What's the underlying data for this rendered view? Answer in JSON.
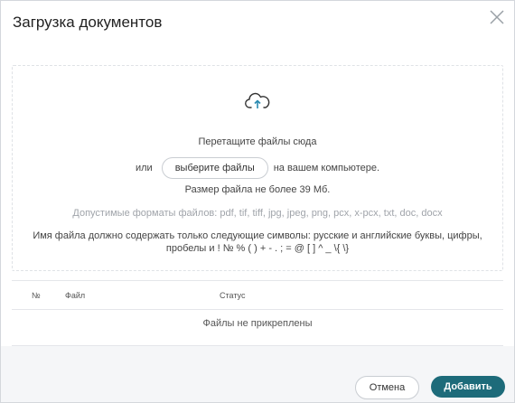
{
  "dialog": {
    "title": "Загрузка документов",
    "close_icon": "close-icon"
  },
  "dropzone": {
    "upload_icon": "cloud-upload-icon",
    "drag_text": "Перетащите файлы сюда",
    "or_text": "или",
    "select_button": "выберите файлы",
    "on_computer_text": "на вашем компьютере.",
    "size_limit": "Размер файла не более 39 Мб.",
    "formats": "Допустимые форматы файлов: pdf, tif, tiff, jpg, jpeg, png, pcx, x-pcx, txt, doc, docx",
    "name_rule_line1": "Имя файла должно содержать только следующие символы: русские и английские буквы, цифры,",
    "name_rule_line2": "пробелы и ! № % ( ) + - . ; = @ [ ] ^ _ \\{ \\}"
  },
  "table": {
    "columns": [
      "№",
      "Файл",
      "Статус"
    ],
    "empty_text": "Файлы не прикреплены"
  },
  "footer": {
    "cancel_label": "Отмена",
    "add_label": "Добавить"
  },
  "colors": {
    "accent": "#1d6b7a",
    "icon_arrow": "#2a8ab0"
  }
}
